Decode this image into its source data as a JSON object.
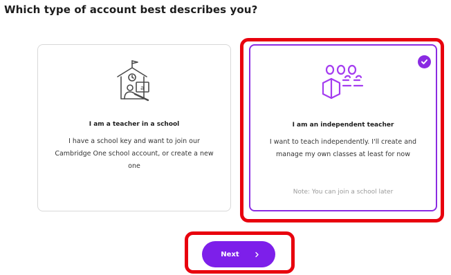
{
  "page": {
    "heading": "Which type of account best describes you?"
  },
  "cards": [
    {
      "title": "I am a teacher in a school",
      "description": "I have a school key and want to join our Cambridge One school account, or create a new one",
      "icon": "school-building-teacher-icon",
      "selected": false
    },
    {
      "title": "I am an independent teacher",
      "description": "I want to teach independently. I'll create and manage my own classes at least for now",
      "note": "Note: You can join a school later",
      "icon": "independent-teacher-students-icon",
      "selected": true
    }
  ],
  "actions": {
    "next_label": "Next"
  },
  "colors": {
    "accent": "#8a2be2",
    "button": "#7d1fea",
    "highlight": "#e8000d"
  }
}
